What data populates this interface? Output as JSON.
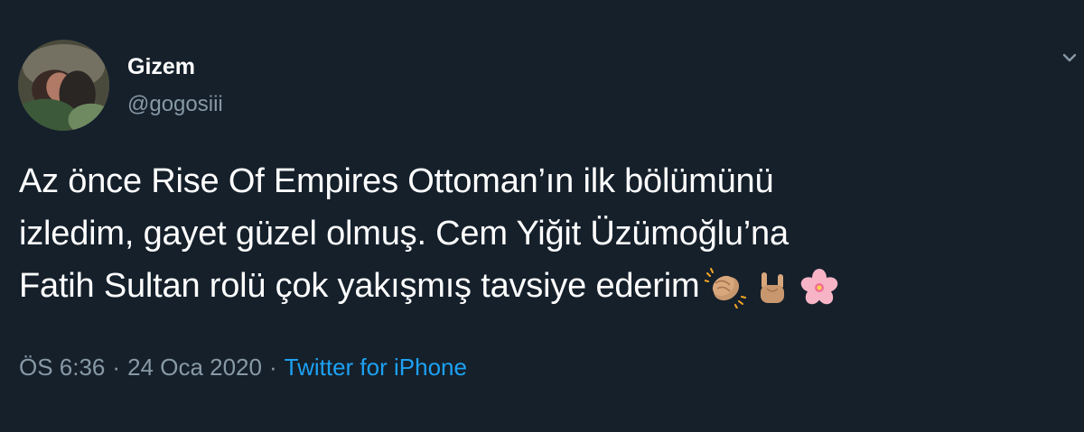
{
  "user": {
    "display_name": "Gizem",
    "handle": "@gogosiii"
  },
  "tweet": {
    "lines": [
      "Az önce Rise Of Empires Ottoman’ın ilk bölümünü",
      "izledim, gayet güzel olmuş. Cem Yiğit Üzümoğlu’na",
      "Fatih Sultan rolü çok yakışmış tavsiye ederim"
    ],
    "emojis": [
      "clapping-hands-emoji",
      "sign-of-horns-emoji",
      "cherry-blossom-emoji"
    ]
  },
  "meta": {
    "time": "ÖS 6:36",
    "date": "24 Oca 2020",
    "separator": "·",
    "source": "Twitter for iPhone"
  },
  "colors": {
    "background": "#15202b",
    "text": "#ffffff",
    "secondary": "#8899a6",
    "link": "#1da1f2"
  }
}
